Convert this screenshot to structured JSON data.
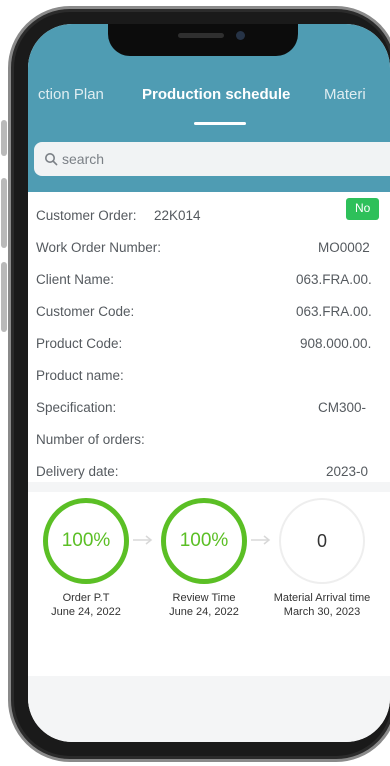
{
  "tabs": {
    "left": "ction Plan",
    "active": "Production schedule",
    "right": "Materi"
  },
  "search": {
    "placeholder": "search"
  },
  "order": {
    "customer_order_label": "Customer Order:",
    "customer_order_value": "22K014",
    "status_badge": "No",
    "rows": [
      {
        "label": "Work Order Number:",
        "value": "MO0002"
      },
      {
        "label": "Client Name:",
        "value": "063.FRA.00."
      },
      {
        "label": "Customer Code:",
        "value": "063.FRA.00."
      },
      {
        "label": "Product Code:",
        "value": "908.000.00."
      },
      {
        "label": "Product name:",
        "value": ""
      },
      {
        "label": "Specification:",
        "value": "CM300-"
      },
      {
        "label": "Number of orders:",
        "value": ""
      },
      {
        "label": "Delivery date:",
        "value": "2023-0"
      }
    ]
  },
  "steps": [
    {
      "value": "100%",
      "title": "Order P.T",
      "date": "June 24, 2022",
      "status": "done"
    },
    {
      "value": "100%",
      "title": "Review Time",
      "date": "June 24, 2022",
      "status": "done"
    },
    {
      "value": "0",
      "title": "Material Arrival time",
      "date": "March 30, 2023",
      "status": "todo"
    }
  ],
  "colors": {
    "header": "#4f9cb3",
    "progress": "#5bbf25",
    "badge": "#2ec05a"
  }
}
